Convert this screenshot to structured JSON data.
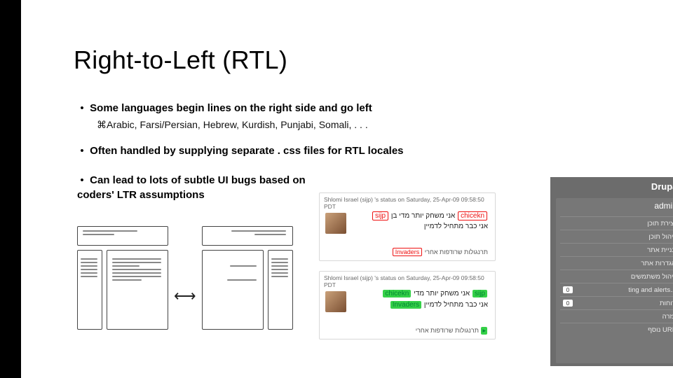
{
  "title": "Right-to-Left (RTL)",
  "bullets": {
    "b1": "Some languages begin lines on the right side and go left",
    "b1_sub_prefix": "Arabic, Farsi/Persian, Hebrew, Kurdish, Punjabi, Somali, . . .",
    "b2": "Often handled by supplying separate . css files for RTL locales",
    "b3": "Can lead to lots of subtle UI bugs based on coders' LTR assumptions"
  },
  "shot_top": {
    "header": "Shlomi Israel (sijp) 's status on Saturday, 25-Apr-09 09:58:50 PDT",
    "tag_left": "sijp",
    "tag_right": "chicekn",
    "line1_mid": "אני משחק יותר מדי בן",
    "line2": "אני כבר מתחיל לדמיין",
    "tag_footer": "Invaders",
    "footer_tail": "תרנגולות שרודפות אחרי"
  },
  "shot_bottom": {
    "header": "Shlomi Israel (sijp) 's status on Saturday, 25-Apr-09 09:58:50 PDT",
    "tag_left": "chicekn",
    "tag_right": "sijp",
    "line1_mid": "אני משחק יותר מדי",
    "tag_mid2": "Invaders",
    "line2_tail": "אני כבר מתחיל לדמיין",
    "footer": "תרנגולות שרודפות אחרי"
  },
  "panel": {
    "brand": "Drupal",
    "user": "admin",
    "items": [
      {
        "label": "יצירת תוכן",
        "badge": ""
      },
      {
        "label": "ניהול תוכן",
        "badge": ""
      },
      {
        "label": "בניית אתר",
        "badge": ""
      },
      {
        "label": "הגדרות אתר",
        "badge": ""
      },
      {
        "label": "ניהול משתמשים",
        "badge": ""
      },
      {
        "label": "...ting and alerts",
        "badge": "0"
      },
      {
        "label": "דוחות",
        "badge": "0"
      },
      {
        "label": "עזרה",
        "badge": ""
      },
      {
        "label": "URL נוסף",
        "badge": ""
      }
    ]
  }
}
